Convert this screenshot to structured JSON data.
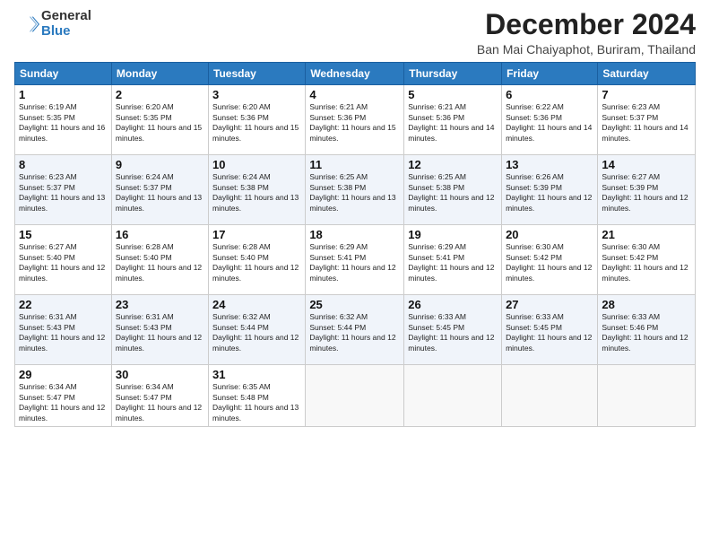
{
  "logo": {
    "general": "General",
    "blue": "Blue"
  },
  "title": "December 2024",
  "location": "Ban Mai Chaiyaphot, Buriram, Thailand",
  "headers": [
    "Sunday",
    "Monday",
    "Tuesday",
    "Wednesday",
    "Thursday",
    "Friday",
    "Saturday"
  ],
  "weeks": [
    [
      {
        "day": "1",
        "sunrise": "6:19 AM",
        "sunset": "5:35 PM",
        "daylight": "11 hours and 16 minutes."
      },
      {
        "day": "2",
        "sunrise": "6:20 AM",
        "sunset": "5:35 PM",
        "daylight": "11 hours and 15 minutes."
      },
      {
        "day": "3",
        "sunrise": "6:20 AM",
        "sunset": "5:36 PM",
        "daylight": "11 hours and 15 minutes."
      },
      {
        "day": "4",
        "sunrise": "6:21 AM",
        "sunset": "5:36 PM",
        "daylight": "11 hours and 15 minutes."
      },
      {
        "day": "5",
        "sunrise": "6:21 AM",
        "sunset": "5:36 PM",
        "daylight": "11 hours and 14 minutes."
      },
      {
        "day": "6",
        "sunrise": "6:22 AM",
        "sunset": "5:36 PM",
        "daylight": "11 hours and 14 minutes."
      },
      {
        "day": "7",
        "sunrise": "6:23 AM",
        "sunset": "5:37 PM",
        "daylight": "11 hours and 14 minutes."
      }
    ],
    [
      {
        "day": "8",
        "sunrise": "6:23 AM",
        "sunset": "5:37 PM",
        "daylight": "11 hours and 13 minutes."
      },
      {
        "day": "9",
        "sunrise": "6:24 AM",
        "sunset": "5:37 PM",
        "daylight": "11 hours and 13 minutes."
      },
      {
        "day": "10",
        "sunrise": "6:24 AM",
        "sunset": "5:38 PM",
        "daylight": "11 hours and 13 minutes."
      },
      {
        "day": "11",
        "sunrise": "6:25 AM",
        "sunset": "5:38 PM",
        "daylight": "11 hours and 13 minutes."
      },
      {
        "day": "12",
        "sunrise": "6:25 AM",
        "sunset": "5:38 PM",
        "daylight": "11 hours and 12 minutes."
      },
      {
        "day": "13",
        "sunrise": "6:26 AM",
        "sunset": "5:39 PM",
        "daylight": "11 hours and 12 minutes."
      },
      {
        "day": "14",
        "sunrise": "6:27 AM",
        "sunset": "5:39 PM",
        "daylight": "11 hours and 12 minutes."
      }
    ],
    [
      {
        "day": "15",
        "sunrise": "6:27 AM",
        "sunset": "5:40 PM",
        "daylight": "11 hours and 12 minutes."
      },
      {
        "day": "16",
        "sunrise": "6:28 AM",
        "sunset": "5:40 PM",
        "daylight": "11 hours and 12 minutes."
      },
      {
        "day": "17",
        "sunrise": "6:28 AM",
        "sunset": "5:40 PM",
        "daylight": "11 hours and 12 minutes."
      },
      {
        "day": "18",
        "sunrise": "6:29 AM",
        "sunset": "5:41 PM",
        "daylight": "11 hours and 12 minutes."
      },
      {
        "day": "19",
        "sunrise": "6:29 AM",
        "sunset": "5:41 PM",
        "daylight": "11 hours and 12 minutes."
      },
      {
        "day": "20",
        "sunrise": "6:30 AM",
        "sunset": "5:42 PM",
        "daylight": "11 hours and 12 minutes."
      },
      {
        "day": "21",
        "sunrise": "6:30 AM",
        "sunset": "5:42 PM",
        "daylight": "11 hours and 12 minutes."
      }
    ],
    [
      {
        "day": "22",
        "sunrise": "6:31 AM",
        "sunset": "5:43 PM",
        "daylight": "11 hours and 12 minutes."
      },
      {
        "day": "23",
        "sunrise": "6:31 AM",
        "sunset": "5:43 PM",
        "daylight": "11 hours and 12 minutes."
      },
      {
        "day": "24",
        "sunrise": "6:32 AM",
        "sunset": "5:44 PM",
        "daylight": "11 hours and 12 minutes."
      },
      {
        "day": "25",
        "sunrise": "6:32 AM",
        "sunset": "5:44 PM",
        "daylight": "11 hours and 12 minutes."
      },
      {
        "day": "26",
        "sunrise": "6:33 AM",
        "sunset": "5:45 PM",
        "daylight": "11 hours and 12 minutes."
      },
      {
        "day": "27",
        "sunrise": "6:33 AM",
        "sunset": "5:45 PM",
        "daylight": "11 hours and 12 minutes."
      },
      {
        "day": "28",
        "sunrise": "6:33 AM",
        "sunset": "5:46 PM",
        "daylight": "11 hours and 12 minutes."
      }
    ],
    [
      {
        "day": "29",
        "sunrise": "6:34 AM",
        "sunset": "5:47 PM",
        "daylight": "11 hours and 12 minutes."
      },
      {
        "day": "30",
        "sunrise": "6:34 AM",
        "sunset": "5:47 PM",
        "daylight": "11 hours and 12 minutes."
      },
      {
        "day": "31",
        "sunrise": "6:35 AM",
        "sunset": "5:48 PM",
        "daylight": "11 hours and 13 minutes."
      },
      null,
      null,
      null,
      null
    ]
  ]
}
